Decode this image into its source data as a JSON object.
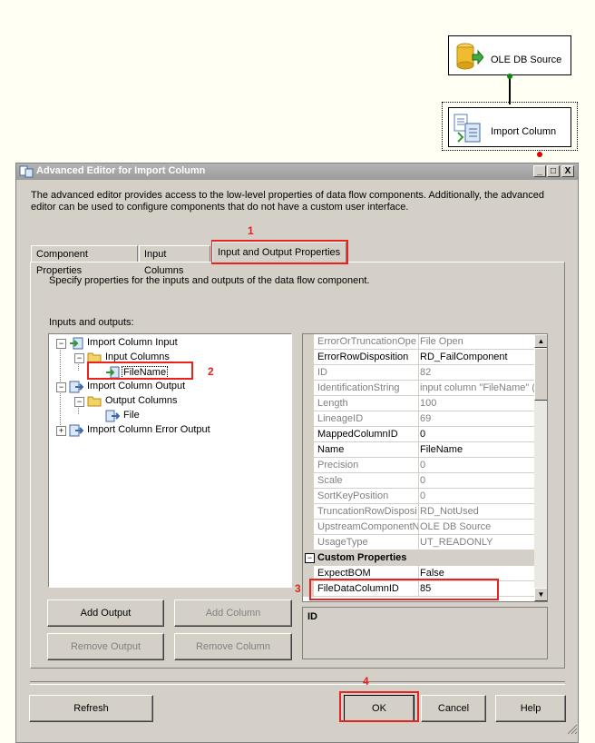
{
  "designer": {
    "source_label": "OLE DB Source",
    "transform_label": "Import Column"
  },
  "dialog": {
    "title": "Advanced Editor for Import Column",
    "title_buttons": [
      "_",
      "□",
      "X"
    ],
    "description": "The advanced editor provides access to the low-level properties of data flow components. Additionally, the advanced editor can be used to configure components that do not have a custom user interface.",
    "tabs": [
      "Component Properties",
      "Input Columns",
      "Input and Output Properties"
    ],
    "panel_description": "Specify properties for the inputs and outputs of the data flow component.",
    "io_label": "Inputs and outputs:",
    "tree": {
      "input": "Import Column Input",
      "input_columns": "Input Columns",
      "filename": "FileName",
      "output": "Import Column Output",
      "output_columns": "Output Columns",
      "file": "File",
      "error_output": "Import Column Error Output"
    },
    "buttons": {
      "add_output": "Add Output",
      "add_column": "Add Column",
      "remove_output": "Remove Output",
      "remove_column": "Remove Column",
      "refresh": "Refresh",
      "ok": "OK",
      "cancel": "Cancel",
      "help": "Help"
    },
    "properties": [
      {
        "name": "ErrorOrTruncationOpe",
        "value": "File Open",
        "readonly": true
      },
      {
        "name": "ErrorRowDisposition",
        "value": "RD_FailComponent",
        "readonly": false
      },
      {
        "name": "ID",
        "value": "82",
        "readonly": true
      },
      {
        "name": "IdentificationString",
        "value": "input column \"FileName\" (8",
        "readonly": true
      },
      {
        "name": "Length",
        "value": "100",
        "readonly": true
      },
      {
        "name": "LineageID",
        "value": "69",
        "readonly": true
      },
      {
        "name": "MappedColumnID",
        "value": "0",
        "readonly": false
      },
      {
        "name": "Name",
        "value": "FileName",
        "readonly": false
      },
      {
        "name": "Precision",
        "value": "0",
        "readonly": true
      },
      {
        "name": "Scale",
        "value": "0",
        "readonly": true
      },
      {
        "name": "SortKeyPosition",
        "value": "0",
        "readonly": true
      },
      {
        "name": "TruncationRowDisposi",
        "value": "RD_NotUsed",
        "readonly": true
      },
      {
        "name": "UpstreamComponentN",
        "value": "OLE DB Source",
        "readonly": true
      },
      {
        "name": "UsageType",
        "value": "UT_READONLY",
        "readonly": true
      }
    ],
    "custom_section": "Custom Properties",
    "custom_properties": [
      {
        "name": "ExpectBOM",
        "value": "False"
      },
      {
        "name": "FileDataColumnID",
        "value": "85"
      }
    ],
    "description_box_title": "ID"
  },
  "annotations": [
    "1",
    "2",
    "3",
    "4"
  ],
  "colors": {
    "annotation": "#e8221f",
    "dialog_bg": "#d4d0c8",
    "canvas_bg": "#fffff4"
  }
}
